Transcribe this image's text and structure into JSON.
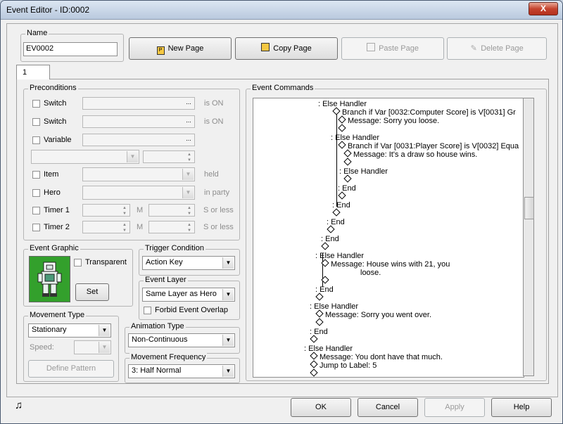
{
  "window": {
    "title": "Event Editor - ID:0002",
    "close_glyph": "X"
  },
  "name_group": {
    "label": "Name",
    "value": "EV0002"
  },
  "page_buttons": {
    "new_page": "New Page",
    "copy_page": "Copy Page",
    "paste_page": "Paste Page",
    "delete_page": "Delete Page"
  },
  "tabs": [
    {
      "label": "1"
    }
  ],
  "preconditions": {
    "title": "Preconditions",
    "switch1": {
      "label": "Switch",
      "suffix": "is ON"
    },
    "switch2": {
      "label": "Switch",
      "suffix": "is ON"
    },
    "variable": {
      "label": "Variable"
    },
    "item": {
      "label": "Item",
      "suffix": "held"
    },
    "hero": {
      "label": "Hero",
      "suffix": "in party"
    },
    "timer1": {
      "label": "Timer 1",
      "m": "M",
      "suffix": "S or less"
    },
    "timer2": {
      "label": "Timer 2",
      "m": "M",
      "suffix": "S or less"
    }
  },
  "event_graphic": {
    "title": "Event Graphic",
    "transparent": "Transparent",
    "set": "Set"
  },
  "trigger": {
    "title": "Trigger Condition",
    "value": "Action Key"
  },
  "event_layer": {
    "title": "Event Layer",
    "value": "Same Layer as Hero",
    "forbid": "Forbid Event Overlap"
  },
  "movement": {
    "title": "Movement Type",
    "value": "Stationary",
    "speed": "Speed:",
    "define": "Define Pattern"
  },
  "animation": {
    "title": "Animation Type",
    "value": "Non-Continuous"
  },
  "frequency": {
    "title": "Movement Frequency",
    "value": "3: Half Normal"
  },
  "event_commands": {
    "title": "Event Commands",
    "lines": [
      ": Else Handler",
      "Branch if Var [0032:Computer Score] is V[0031] Gr",
      "Message: Sorry you loose.",
      "",
      ": Else Handler",
      "Branch if Var [0031:Player Score] is V[0032] Equa",
      "Message: It's a draw so house wins.",
      "",
      ": Else Handler",
      "",
      ": End",
      "",
      ": End",
      "",
      ": End",
      "",
      ": End",
      "",
      ": Else Handler",
      "Message: House wins with 21, you",
      "loose.",
      "",
      ": End",
      "",
      ": Else Handler",
      "Message: Sorry you went over.",
      "",
      ": End",
      "",
      ": Else Handler",
      "Message: You dont have that much.",
      "Jump to Label: 5",
      ""
    ]
  },
  "bottom": {
    "ok": "OK",
    "cancel": "Cancel",
    "apply": "Apply",
    "help": "Help",
    "music_icon": "music-note-icon"
  }
}
